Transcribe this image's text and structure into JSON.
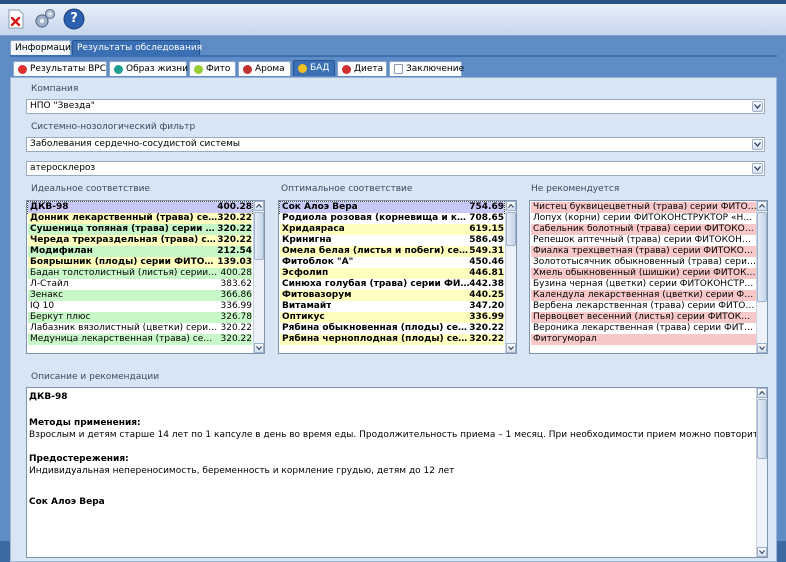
{
  "toolbar": {
    "close_icon": "close-icon",
    "settings_icon": "gear-icon",
    "help_icon": "help-icon",
    "help_glyph": "?"
  },
  "outer_tabs": [
    {
      "label": "Информация",
      "active": false
    },
    {
      "label": "Результаты обследования",
      "active": true
    }
  ],
  "inner_tabs": [
    {
      "label": "Результаты ВРС",
      "icon": "heart-icon",
      "color": "#e03030"
    },
    {
      "label": "Образ жизни",
      "icon": "globe-icon",
      "color": "#1e9e8e"
    },
    {
      "label": "Фито",
      "icon": "flower-icon",
      "color": "#9acd32"
    },
    {
      "label": "Арома",
      "icon": "rose-icon",
      "color": "#c03030"
    },
    {
      "label": "БАД",
      "icon": "coin-icon",
      "color": "#f0c020",
      "active": true
    },
    {
      "label": "Диета",
      "icon": "strawberry-icon",
      "color": "#d03030"
    },
    {
      "label": "Заключение",
      "icon": "document-icon",
      "color": "#ffffff"
    }
  ],
  "labels": {
    "company": "Компания",
    "filter": "Системно-нозологический фильтр",
    "ideal": "Идеальное соответствие",
    "optimal": "Оптимальное соответствие",
    "not_recommended": "Не рекомендуется",
    "description": "Описание и рекомендации"
  },
  "combos": {
    "company": "НПО \"Звезда\"",
    "system": "Заболевания сердечно-сосудистой системы",
    "disease": "атеросклероз"
  },
  "colors": {
    "blue": "#c8c8f8",
    "yellow": "#ffffc0",
    "green": "#c8f8c8",
    "pink": "#f8c8c8",
    "white": "#ffffff"
  },
  "ideal_list": [
    {
      "name": "ДКВ-98",
      "score": "400.28",
      "bold": true,
      "color": "blue"
    },
    {
      "name": "Донник лекарственный (трава) сери...",
      "score": "320.22",
      "bold": true,
      "color": "yellow"
    },
    {
      "name": "Сушеница топяная (трава) серии ФИ...",
      "score": "320.22",
      "bold": true,
      "color": "green"
    },
    {
      "name": "Череда трехраздельная (трава) сер...",
      "score": "320.22",
      "bold": true,
      "color": "yellow"
    },
    {
      "name": "Модифилан",
      "score": "212.54",
      "bold": true,
      "color": "green"
    },
    {
      "name": "Боярышник (плоды) серии ФИТОКОН...",
      "score": "139.03",
      "bold": true,
      "color": "yellow"
    },
    {
      "name": "Бадан толстолистный (листья) серии ФИ...",
      "score": "400.28",
      "bold": false,
      "color": "green"
    },
    {
      "name": "Л-Стайл",
      "score": "383.62",
      "bold": false,
      "color": "white"
    },
    {
      "name": "Зенакс",
      "score": "366.86",
      "bold": false,
      "color": "green"
    },
    {
      "name": "IQ 10",
      "score": "336.99",
      "bold": false,
      "color": "white"
    },
    {
      "name": "Беркут плюс",
      "score": "326.78",
      "bold": false,
      "color": "green"
    },
    {
      "name": "Лабазник вязолистный (цветки) серии Ф...",
      "score": "320.22",
      "bold": false,
      "color": "white"
    },
    {
      "name": "Медуница лекарственная (трава) серии ...",
      "score": "320.22",
      "bold": false,
      "color": "green"
    }
  ],
  "optimal_list": [
    {
      "name": "Сок Алоэ Вера",
      "score": "754.69",
      "bold": true,
      "color": "blue"
    },
    {
      "name": "Родиола розовая (корневища и корн...",
      "score": "708.65",
      "bold": true,
      "color": "white"
    },
    {
      "name": "Хридаяраса",
      "score": "619.15",
      "bold": true,
      "color": "yellow"
    },
    {
      "name": "Кринигна",
      "score": "586.49",
      "bold": true,
      "color": "white"
    },
    {
      "name": "Омела белая (листья и побеги) сери...",
      "score": "549.31",
      "bold": true,
      "color": "yellow"
    },
    {
      "name": "Фитоблок \"А\"",
      "score": "450.46",
      "bold": true,
      "color": "white"
    },
    {
      "name": "Эсфолип",
      "score": "446.81",
      "bold": true,
      "color": "yellow"
    },
    {
      "name": "Синюха голубая (трава) серии ФИТО...",
      "score": "442.38",
      "bold": true,
      "color": "white"
    },
    {
      "name": "Фитовазорум",
      "score": "440.25",
      "bold": true,
      "color": "yellow"
    },
    {
      "name": "Витамайт",
      "score": "347.20",
      "bold": true,
      "color": "white"
    },
    {
      "name": "Оптикус",
      "score": "336.99",
      "bold": true,
      "color": "yellow"
    },
    {
      "name": "Рябина обыкновенная (плоды) сери...",
      "score": "320.22",
      "bold": true,
      "color": "white"
    },
    {
      "name": "Рябина черноплодная (плоды) сери...",
      "score": "320.22",
      "bold": true,
      "color": "yellow"
    }
  ],
  "not_recommended_list": [
    {
      "name": "Чистец буквицецветный (трава) серии ФИТОКОН...",
      "color": "pink"
    },
    {
      "name": "Лопух (корни) серии ФИТОКОНСТРУКТОР «НП...",
      "color": "white"
    },
    {
      "name": "Сабельник болотный (трава) серии ФИТОКОНСТ...",
      "color": "pink"
    },
    {
      "name": "Репешок аптечный (трава) серии ФИТОКОНСТР...",
      "color": "white"
    },
    {
      "name": "Фиалка трехцветная (трава) серии ФИТОКОНСТ...",
      "color": "pink"
    },
    {
      "name": "Золототысячник обыкновенный (трава) серии ФИ...",
      "color": "white"
    },
    {
      "name": "Хмель обыкновенный (шишки) серии ФИТОКОН...",
      "color": "pink"
    },
    {
      "name": "Бузина черная (цветки) серии ФИТОКОНСТРУКТ...",
      "color": "white"
    },
    {
      "name": "Календула лекарственная (цветки) серии ФИТО...",
      "color": "pink"
    },
    {
      "name": "Вербена лекарственная (трава) серии ФИТОКОН...",
      "color": "white"
    },
    {
      "name": "Первоцвет весенний (листья) серии ФИТОКОНС...",
      "color": "pink"
    },
    {
      "name": "Вероника лекарственная (трава) серии ФИТОКО...",
      "color": "white"
    },
    {
      "name": "Фитогуморал",
      "color": "pink"
    }
  ],
  "description": {
    "title1": "ДКВ-98",
    "methods_heading": "Методы применения:",
    "methods_text": "Взрослым и детям старше 14 лет по 1 капсуле в день во время еды. Продолжительность приема – 1 месяц. При необходимости прием можно повторить.",
    "warnings_heading": "Предостережения:",
    "warnings_text": "Индивидуальная непереносимость, беременность и кормление грудью, детям до 12 лет",
    "title2": "Сок Алоэ Вера"
  }
}
